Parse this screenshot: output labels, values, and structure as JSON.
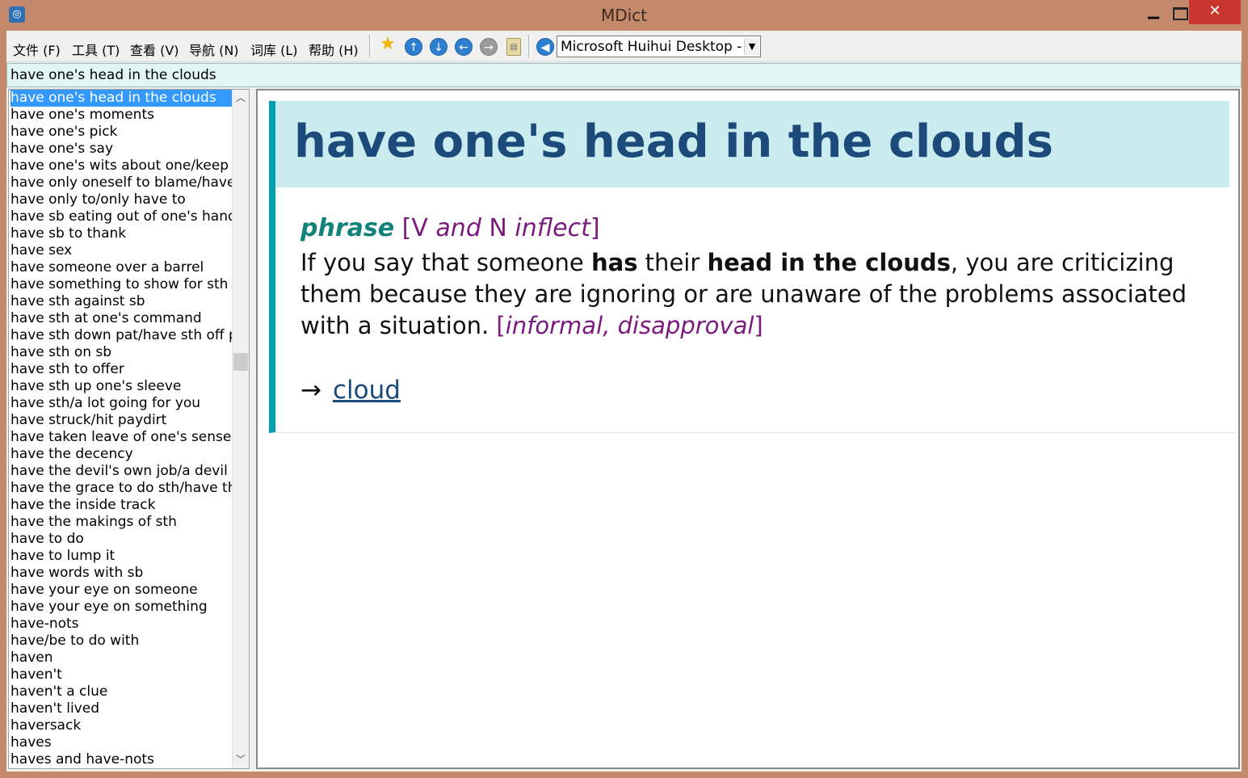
{
  "window": {
    "title": "MDict"
  },
  "menu": [
    "文件 (F)",
    "工具 (T)",
    "查看 (V)",
    "导航 (N)",
    "词库 (L)",
    "帮助 (H)"
  ],
  "toolbar": {
    "icons": [
      "favorite-star-icon",
      "arrow-up-icon",
      "arrow-down-icon",
      "arrow-back-icon",
      "arrow-forward-icon",
      "clipboard-icon",
      "speaker-icon"
    ],
    "dictionary_selected": "Microsoft Huihui Desktop - Cl"
  },
  "search": {
    "value": "have one's head in the clouds"
  },
  "wordlist": {
    "selected_index": 0,
    "items": [
      "have one's head in the clouds",
      "have one's moments",
      "have one's pick",
      "have one's say",
      "have one's wits about one/keep o",
      "have only oneself to blame/have r",
      "have only to/only have to",
      "have sb eating out of one's hand",
      "have sb to thank",
      "have sex",
      "have someone over a barrel",
      "have something to show for sth",
      "have sth against sb",
      "have sth at one's command",
      "have sth down pat/have sth off pa",
      "have sth on sb",
      "have sth to offer",
      "have sth up one's sleeve",
      "have sth/a lot going for you",
      "have struck/hit paydirt",
      "have taken leave of one's senses",
      "have the decency",
      "have the devil's own job/a devil o",
      "have the grace to do sth/have the",
      "have the inside track",
      "have the makings of sth",
      "have to do",
      "have to lump it",
      "have words with sb",
      "have your eye on someone",
      "have your eye on something",
      "have-nots",
      "have/be to do with",
      "haven",
      "haven't",
      "haven't a clue",
      "haven't lived",
      "haversack",
      "haves",
      "haves and have-nots"
    ]
  },
  "entry": {
    "headword": "have one's head in the clouds",
    "pos": "phrase",
    "gram_open": "[",
    "gram_v": "V",
    "gram_and": "and",
    "gram_n": "N",
    "gram_inflect": "inflect",
    "gram_close": "]",
    "def_1": "If you say that someone ",
    "def_b1": "has",
    "def_2": " their ",
    "def_b2": "head in the clouds",
    "def_3": ", you are criticizing them because they are ignoring or are unaware of the problems associated with a situation. ",
    "label_open": "[",
    "label_text": "informal, disapproval",
    "label_close": "]",
    "xref_arrow": "→",
    "xref_word": "cloud"
  }
}
